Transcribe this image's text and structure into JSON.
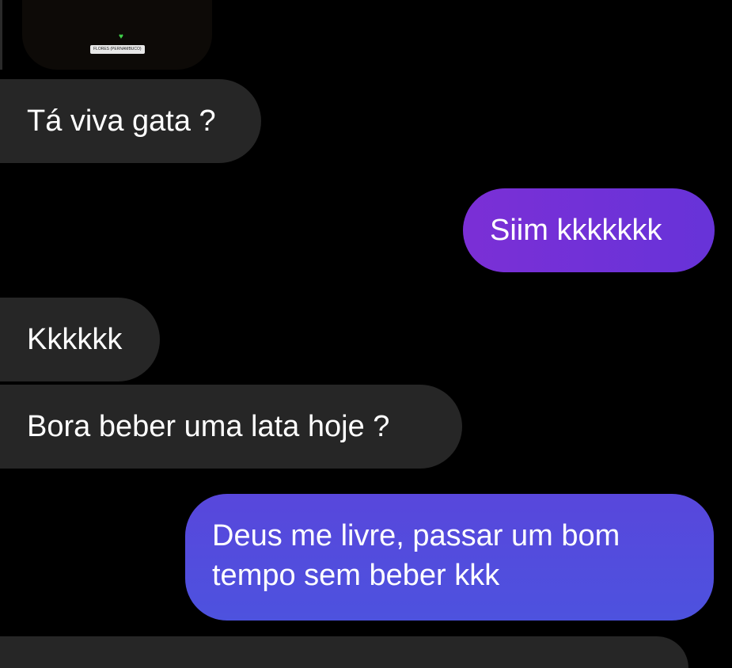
{
  "story": {
    "heart_icon": "green-heart-icon",
    "heart_glyph": "♥",
    "location_label": "FLORES (PERNAMBUCO)",
    "heart_color": "#3fd24a"
  },
  "messages": [
    {
      "direction": "received",
      "text": "Tá viva gata ?"
    },
    {
      "direction": "sent",
      "text": "Siim kkkkkkk"
    },
    {
      "direction": "received",
      "text": "Kkkkkk"
    },
    {
      "direction": "received",
      "text": "Bora beber uma lata hoje ?"
    },
    {
      "direction": "sent",
      "lines": [
        "Deus me livre, passar um bom",
        "tempo sem beber kkk"
      ]
    }
  ],
  "colors": {
    "background": "#000000",
    "received_bubble": "#262626",
    "sent_bubble_purple": "#7b2fd6",
    "sent_bubble_blue": "#4d52de",
    "text": "#ffffff"
  }
}
